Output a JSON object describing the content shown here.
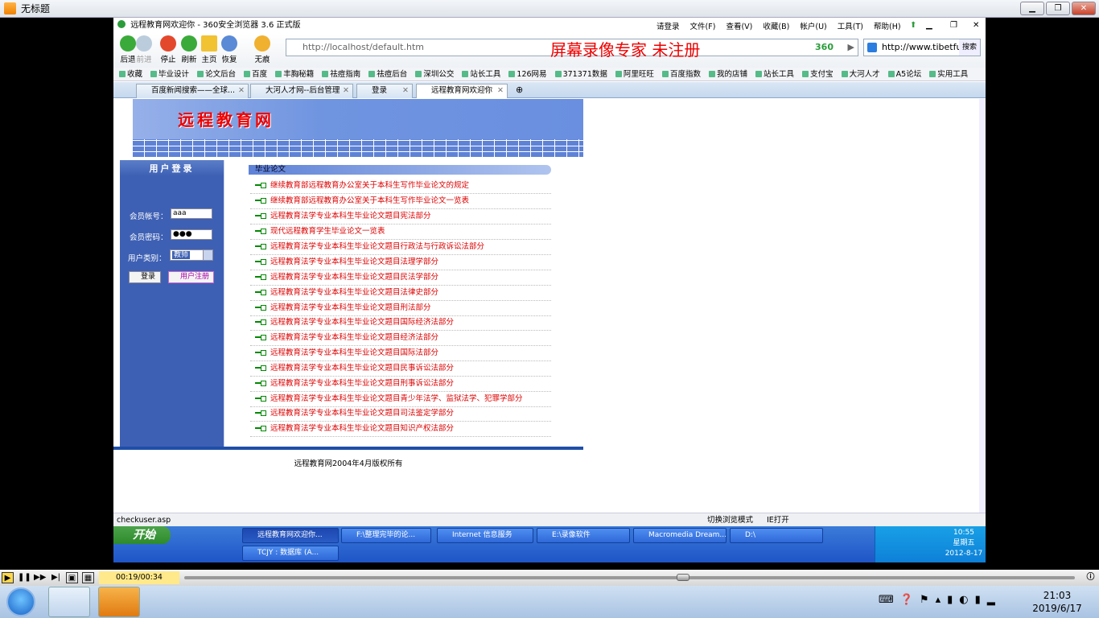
{
  "player": {
    "title": "无标题",
    "time": "00:19/00:34",
    "playback_fraction": 0.56
  },
  "browser": {
    "title": "远程教育网欢迎你 - 360安全浏览器 3.6 正式版",
    "watermark": "屏幕录像专家  未注册",
    "menu": [
      "请登录",
      "文件(F)",
      "查看(V)",
      "收藏(B)",
      "帐户(U)",
      "工具(T)",
      "帮助(H)"
    ],
    "nav": [
      "后退",
      "前进",
      "停止",
      "刷新",
      "主页",
      "恢复",
      "无痕"
    ],
    "address": "http://localhost/default.htm",
    "engine": "360",
    "search_value": "http://www.tibetfuh",
    "search_btn": "搜索",
    "favorites": [
      "收藏",
      "毕业设计",
      "论文后台",
      "百度",
      "丰胸秘籍",
      "祛痘指南",
      "祛痘后台",
      "深圳公交",
      "站长工具",
      "126网易",
      "371371数据",
      "阿里旺旺",
      "百度指数",
      "我的店铺",
      "站长工具",
      "支付宝",
      "大河人才",
      "A5论坛",
      "实用工具"
    ],
    "tabs": [
      "百度新闻搜索——全球...",
      "大河人才网--后台管理",
      "登录",
      "远程教育网欢迎你"
    ],
    "status_left": "checkuser.asp",
    "status_right": [
      "切换浏览模式",
      "IE打开"
    ]
  },
  "site": {
    "logo": "远程教育网",
    "login": {
      "title": "用户登录",
      "user_label": "会员帐号：",
      "user_value": "aaa",
      "pass_label": "会员密码：",
      "pass_value": "●●●",
      "type_label": "用户类别：",
      "type_value": "教师",
      "login_btn": "登录",
      "register_btn": "用户注册"
    },
    "section": "毕业论文",
    "articles": [
      "继续教育部远程教育办公室关于本科生写作毕业论文的规定",
      "继续教育部远程教育办公室关于本科生写作毕业论文一览表",
      "远程教育法学专业本科生毕业论文题目宪法部分",
      "现代远程教育学生毕业论文一览表",
      "远程教育法学专业本科生毕业论文题目行政法与行政诉讼法部分",
      "远程教育法学专业本科生毕业论文题目法理学部分",
      "远程教育法学专业本科生毕业论文题目民法学部分",
      "远程教育法学专业本科生毕业论文题目法律史部分",
      "远程教育法学专业本科生毕业论文题目刑法部分",
      "远程教育法学专业本科生毕业论文题目国际经济法部分",
      "远程教育法学专业本科生毕业论文题目经济法部分",
      "远程教育法学专业本科生毕业论文题目国际法部分",
      "远程教育法学专业本科生毕业论文题目民事诉讼法部分",
      "远程教育法学专业本科生毕业论文题目刑事诉讼法部分",
      "远程教育法学专业本科生毕业论文题目青少年法学、监狱法学、犯罪学部分",
      "远程教育法学专业本科生毕业论文题目司法鉴定学部分",
      "远程教育法学专业本科生毕业论文题目知识产权法部分"
    ],
    "footer": "远程教育网2004年4月版权所有"
  },
  "xp_taskbar": {
    "start": "开始",
    "items": [
      "远程教育网欢迎你...",
      "F:\\整理完毕的论...",
      "Internet 信息服务",
      "E:\\录像软件",
      "Macromedia Dream...",
      "D:\\",
      "TCJY : 数据库 (A..."
    ],
    "clock_time": "10:55",
    "clock_day": "星期五",
    "clock_date": "2012-8-17"
  },
  "win7": {
    "time": "21:03",
    "date": "2019/6/17"
  }
}
